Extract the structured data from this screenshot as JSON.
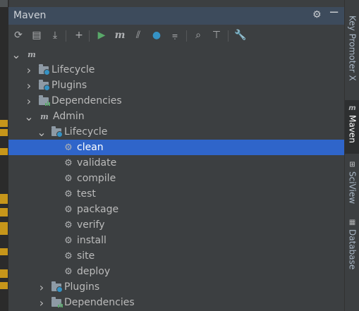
{
  "panel": {
    "title": "Maven",
    "settings_icon": "gear-icon",
    "hide_icon": "minimize-icon"
  },
  "toolbar": {
    "buttons": [
      {
        "name": "reload-icon",
        "glyph": "⟳"
      },
      {
        "name": "generate-sources-icon",
        "glyph": "▤"
      },
      {
        "name": "download-icon",
        "glyph": "⤓"
      },
      {
        "name": "add-icon",
        "glyph": "+"
      },
      {
        "name": "run-icon",
        "glyph": "▶"
      },
      {
        "name": "execute-goal-icon",
        "glyph": "m"
      },
      {
        "name": "toggle-offline-icon",
        "glyph": "⫽"
      },
      {
        "name": "skip-tests-icon",
        "glyph": "●"
      },
      {
        "name": "show-dependencies-icon",
        "glyph": "⩦"
      },
      {
        "name": "collapse-all-icon",
        "glyph": "⌕"
      },
      {
        "name": "expand-all-icon",
        "glyph": "⊤"
      },
      {
        "name": "build-settings-icon",
        "glyph": "🔧"
      }
    ]
  },
  "tree": {
    "root_icon": "maven-project-icon",
    "root": {
      "label": ""
    },
    "lifecycle": {
      "label": "Lifecycle"
    },
    "plugins": {
      "label": "Plugins"
    },
    "dependencies": {
      "label": "Dependencies"
    },
    "admin": {
      "label": "Admin"
    },
    "admin_lifecycle": {
      "label": "Lifecycle"
    },
    "goals": [
      "clean",
      "validate",
      "compile",
      "test",
      "package",
      "verify",
      "install",
      "site",
      "deploy"
    ],
    "selected_goal": "clean",
    "admin_plugins": {
      "label": "Plugins"
    },
    "admin_dependencies": {
      "label": "Dependencies"
    }
  },
  "right_stripe": {
    "tabs": [
      {
        "label": "Key Promoter X",
        "icon": "key-icon"
      },
      {
        "label": "Maven",
        "icon": "maven-icon",
        "active": true
      },
      {
        "label": "SciView",
        "icon": "grid-icon"
      },
      {
        "label": "Database",
        "icon": "database-icon"
      }
    ]
  },
  "colors": {
    "selection": "#2f65ca",
    "title_bar": "#3d4b5c",
    "run_green": "#59a869",
    "accent_blue": "#3592c4",
    "gutter_mark": "#c7961a"
  }
}
